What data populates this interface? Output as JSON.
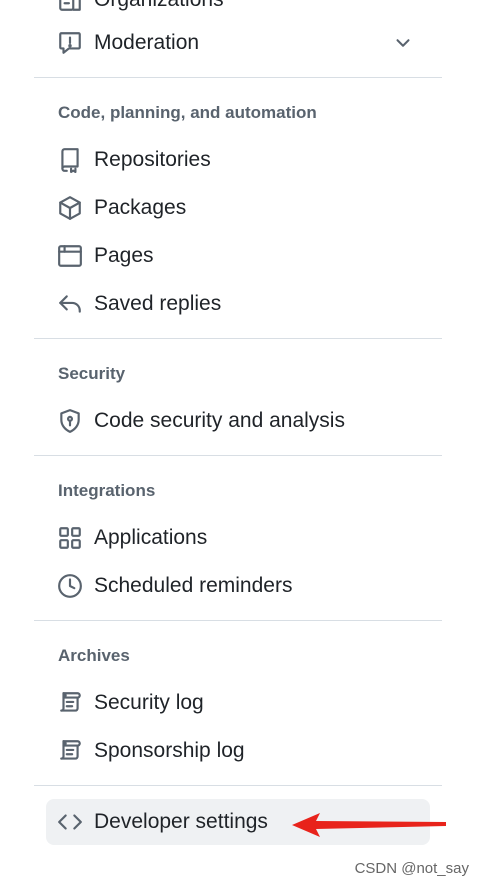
{
  "nav_top": [
    {
      "label": "Organizations",
      "icon": "organization-icon"
    },
    {
      "label": "Moderation",
      "icon": "report-icon",
      "expandable": true
    }
  ],
  "sections": [
    {
      "title": "Code, planning, and automation",
      "items": [
        {
          "label": "Repositories",
          "icon": "repo-icon"
        },
        {
          "label": "Packages",
          "icon": "package-icon"
        },
        {
          "label": "Pages",
          "icon": "browser-icon"
        },
        {
          "label": "Saved replies",
          "icon": "reply-icon"
        }
      ]
    },
    {
      "title": "Security",
      "items": [
        {
          "label": "Code security and analysis",
          "icon": "shield-lock-icon"
        }
      ]
    },
    {
      "title": "Integrations",
      "items": [
        {
          "label": "Applications",
          "icon": "apps-icon"
        },
        {
          "label": "Scheduled reminders",
          "icon": "clock-icon"
        }
      ]
    },
    {
      "title": "Archives",
      "items": [
        {
          "label": "Security log",
          "icon": "log-icon"
        },
        {
          "label": "Sponsorship log",
          "icon": "log-icon"
        }
      ]
    }
  ],
  "developer_settings": {
    "label": "Developer settings",
    "icon": "code-icon",
    "active": true
  },
  "annotation": {
    "arrow_color": "#e8231b"
  },
  "watermark": "CSDN @not_say",
  "colors": {
    "text": "#1f2328",
    "muted": "#59636e",
    "divider": "#d8dee4",
    "active_bg": "#eff1f3"
  }
}
